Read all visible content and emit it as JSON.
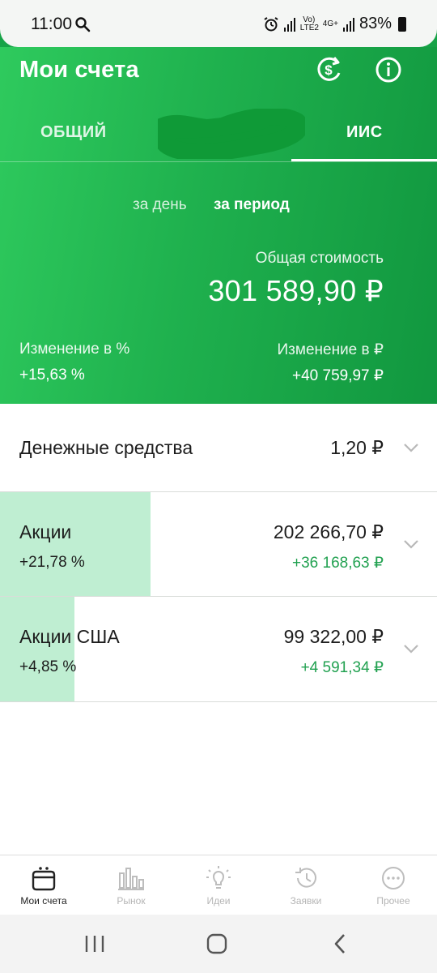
{
  "status_bar": {
    "time": "11:00",
    "network_text": "Vo) LTE2",
    "network_text2": "4G+",
    "battery": "83%"
  },
  "header": {
    "title": "Мои счета",
    "icon_left": "dollar-refresh-icon",
    "icon_right": "info-icon"
  },
  "tabs": [
    {
      "label": "ОБЩИЙ",
      "active": false
    },
    {
      "label": "ИИС",
      "active": true
    }
  ],
  "period": {
    "day_label": "за день",
    "range_label": "за период",
    "selected": "за период"
  },
  "summary": {
    "total_label": "Общая стоимость",
    "total_value": "301 589,90 ₽",
    "change_pct_label": "Изменение в  %",
    "change_pct_value": "+15,63  %",
    "change_rub_label": "Изменение в ₽",
    "change_rub_value": "+40 759,97 ₽"
  },
  "holdings": [
    {
      "name": "Денежные средства",
      "amount": "1,20 ₽",
      "share": 0
    },
    {
      "name": "Акции",
      "change_pct": "+21,78  %",
      "amount": "202 266,70 ₽",
      "delta": "+36 168,63 ₽",
      "share": 0.3447
    },
    {
      "name": "Акции США",
      "change_pct": "+4,85  %",
      "amount": "99 322,00 ₽",
      "delta": "+4 591,34 ₽",
      "share": 0.1704
    }
  ],
  "bottom_nav": [
    {
      "label": "Мои счета",
      "icon": "wallet-icon",
      "active": true
    },
    {
      "label": "Рынок",
      "icon": "bar-chart-icon",
      "active": false
    },
    {
      "label": "Идеи",
      "icon": "lightbulb-icon",
      "active": false
    },
    {
      "label": "Заявки",
      "icon": "history-icon",
      "active": false
    },
    {
      "label": "Прочее",
      "icon": "more-icon",
      "active": false
    }
  ],
  "colors": {
    "brand_green": "#1fb14e",
    "delta_green": "#21a150",
    "fill_green": "#bfeed2"
  }
}
